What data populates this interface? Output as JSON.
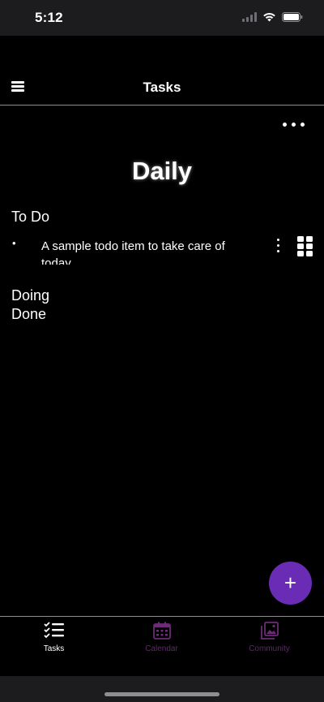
{
  "status_bar": {
    "time": "5:12"
  },
  "header": {
    "title": "Tasks",
    "menu_icon": "hamburger-menu-icon"
  },
  "page": {
    "title": "Daily",
    "more_icon": "more-horizontal-icon"
  },
  "sections": {
    "todo": {
      "heading": "To Do",
      "items": [
        {
          "bullet": "•",
          "text": "A sample todo item to take care of today"
        }
      ]
    },
    "doing": {
      "heading": "Doing"
    },
    "done": {
      "heading": "Done"
    }
  },
  "fab": {
    "symbol": "+"
  },
  "tabs": [
    {
      "label": "Tasks",
      "icon": "checklist-icon",
      "active": true
    },
    {
      "label": "Calendar",
      "icon": "calendar-icon",
      "active": false
    },
    {
      "label": "Community",
      "icon": "photo-gallery-icon",
      "active": false
    }
  ],
  "colors": {
    "background": "#000000",
    "accent": "#6a2bb5",
    "inactive_tab": "#5e2a6b",
    "divider": "#8e8e93"
  }
}
